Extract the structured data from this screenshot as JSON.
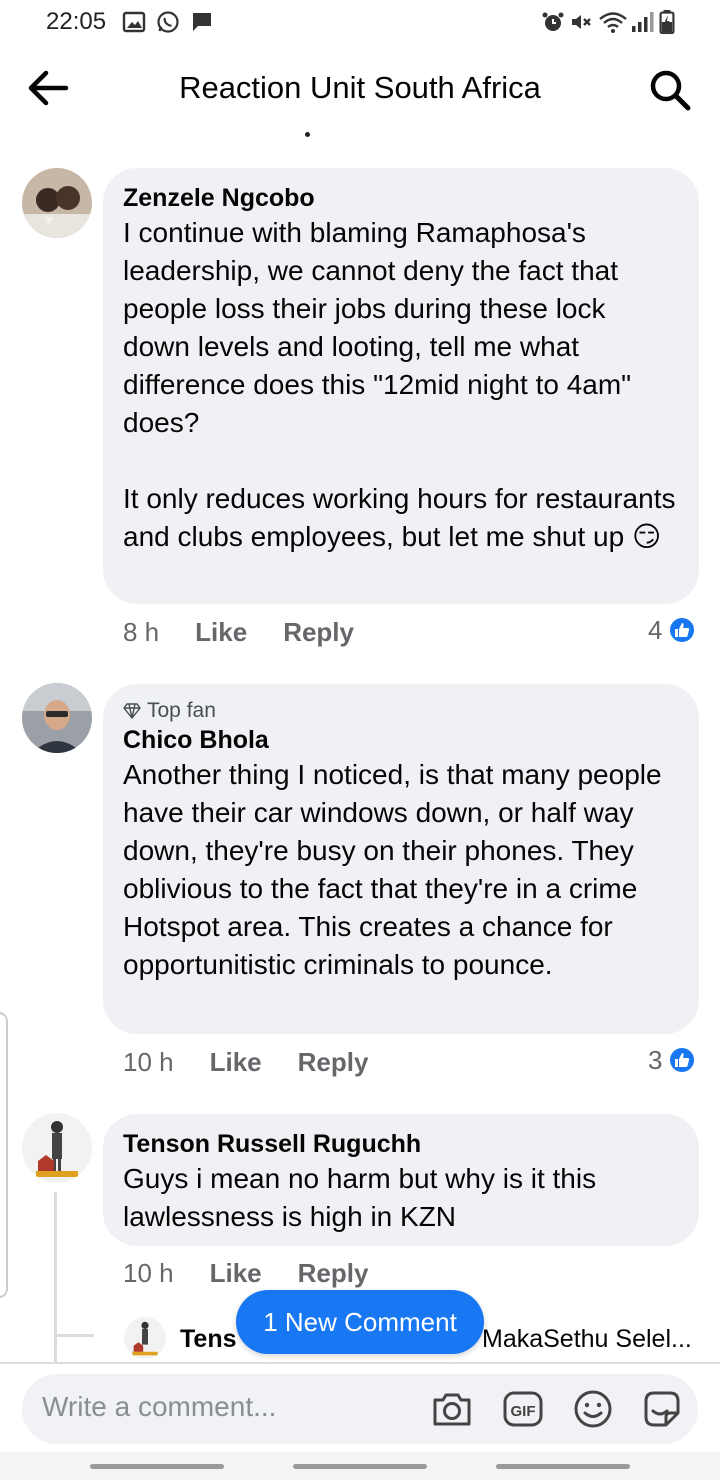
{
  "status_bar": {
    "time": "22:05",
    "left_icons": [
      "image-icon",
      "whatsapp-icon",
      "message-icon"
    ],
    "right_icons": [
      "alarm-icon",
      "mute-icon",
      "wifi-icon",
      "signal-icon",
      "battery-charging-icon"
    ]
  },
  "header": {
    "title": "Reaction Unit South Africa",
    "back_icon": "arrow-left-icon",
    "search_icon": "search-icon"
  },
  "comments": [
    {
      "author": "Zenzele Ngcobo",
      "badge": "",
      "text": "I continue with blaming Ramaphosa's leadership, we cannot deny the fact that people loss their jobs during these lock down levels and looting, tell me what difference does this \"12mid night to 4am\" does?\n\n It only reduces working hours for restaurants and clubs employees, but let me shut up 😏",
      "time": "8 h",
      "like_label": "Like",
      "reply_label": "Reply",
      "reactions": "4"
    },
    {
      "author": "Chico Bhola",
      "badge": "Top fan",
      "text": "Another thing I noticed, is that many people have their car windows down, or half way down, they're busy on their phones. They oblivious to the fact that they're in a crime Hotspot area. This creates a chance for opportunitistic criminals to pounce.",
      "time": "10 h",
      "like_label": "Like",
      "reply_label": "Reply",
      "reactions": "3"
    },
    {
      "author": "Tenson Russell Ruguchh",
      "badge": "",
      "text": "Guys i mean no harm but why is it this lawlessness is high in KZN",
      "time": "10 h",
      "like_label": "Like",
      "reply_label": "Reply",
      "reactions": ""
    }
  ],
  "reply_preview": {
    "name": "Tens",
    "tail": "MakaSethu Selel..."
  },
  "new_comment_label": "1 New Comment",
  "composer": {
    "placeholder": "Write a comment...",
    "icons": [
      "camera-icon",
      "gif-icon",
      "emoji-icon",
      "sticker-icon"
    ]
  },
  "colors": {
    "accent": "#1877f2",
    "bubble": "#eff1f4",
    "meta_text": "#65676b"
  }
}
